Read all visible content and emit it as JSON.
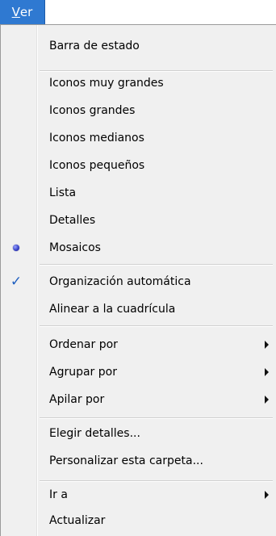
{
  "menu_title": {
    "mnemonic": "V",
    "rest": "er"
  },
  "items": {
    "status_bar": "Barra de estado",
    "extra_large_icons": "Iconos muy grandes",
    "large_icons": "Iconos grandes",
    "medium_icons": "Iconos medianos",
    "small_icons": "Iconos pequeños",
    "list": "Lista",
    "details": "Detalles",
    "tiles": "Mosaicos",
    "auto_arrange": "Organización automática",
    "align_to_grid": "Alinear a la cuadrícula",
    "sort_by": "Ordenar por",
    "group_by": "Agrupar por",
    "stack_by": "Apilar por",
    "choose_details": "Elegir detalles...",
    "customize_folder": "Personalizar esta carpeta...",
    "go_to": "Ir a",
    "refresh": "Actualizar"
  },
  "icons": {
    "tiles_indicator": "radio-dot-icon",
    "auto_arrange_indicator": "checkmark-icon",
    "submenu_indicator": "submenu-arrow-icon"
  },
  "colors": {
    "menu_title_highlight": "#2f79d1",
    "menu_background": "#f0f0f0",
    "checkmark": "#1f5fc0",
    "radio_dot": "#3a44c8"
  }
}
